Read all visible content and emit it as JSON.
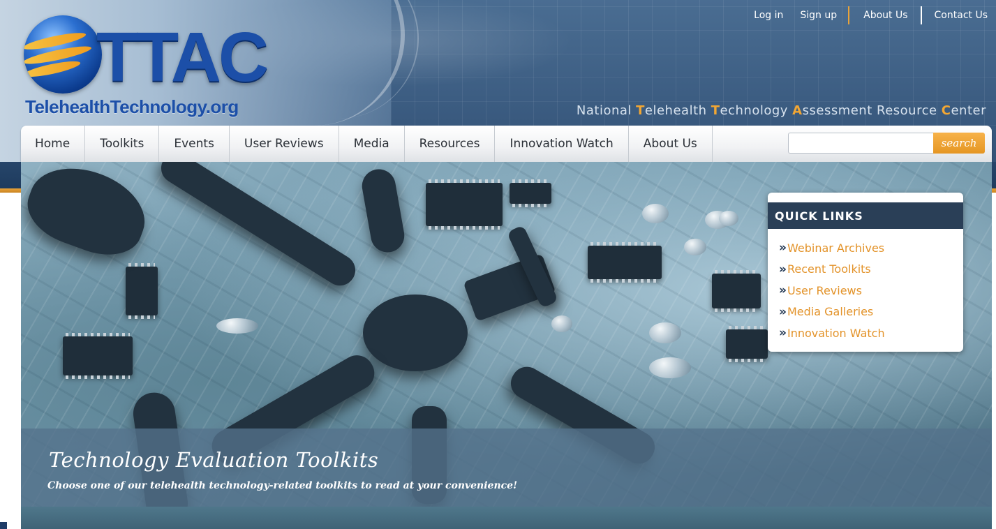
{
  "logo": {
    "acronym": "TTAC",
    "site": "TelehealthTechnology.org"
  },
  "top_links": [
    {
      "label": "Log in"
    },
    {
      "label": "Sign up"
    },
    {
      "label": "About Us"
    },
    {
      "label": "Contact Us"
    }
  ],
  "tagline": {
    "parts": [
      {
        "text": "National ",
        "highlight": false
      },
      {
        "text": "T",
        "highlight": true
      },
      {
        "text": "elehealth ",
        "highlight": false
      },
      {
        "text": "T",
        "highlight": true
      },
      {
        "text": "echnology ",
        "highlight": false
      },
      {
        "text": "A",
        "highlight": true
      },
      {
        "text": "ssessment Resource ",
        "highlight": false
      },
      {
        "text": "C",
        "highlight": true
      },
      {
        "text": "enter",
        "highlight": false
      }
    ]
  },
  "nav": {
    "items": [
      {
        "label": "Home"
      },
      {
        "label": "Toolkits"
      },
      {
        "label": "Events"
      },
      {
        "label": "User Reviews"
      },
      {
        "label": "Media"
      },
      {
        "label": "Resources"
      },
      {
        "label": "Innovation Watch"
      },
      {
        "label": "About Us"
      }
    ],
    "search": {
      "value": "",
      "placeholder": "",
      "button_label": "search"
    }
  },
  "quick_links": {
    "title": "QUICK LINKS",
    "chevron": "»",
    "items": [
      {
        "label": "Webinar Archives"
      },
      {
        "label": "Recent Toolkits"
      },
      {
        "label": "User Reviews"
      },
      {
        "label": "Media Galleries"
      },
      {
        "label": "Innovation Watch"
      }
    ]
  },
  "hero": {
    "title": "Technology Evaluation Toolkits",
    "subtitle": "Choose one of our telehealth technology-related toolkits to read at your convenience!"
  },
  "colors": {
    "accent_orange": "#e9a33a",
    "link_orange": "#e3932a",
    "header_blue": "#3e5f84",
    "quicklinks_header": "#2a3f57",
    "logo_blue": "#1c4fa8"
  }
}
